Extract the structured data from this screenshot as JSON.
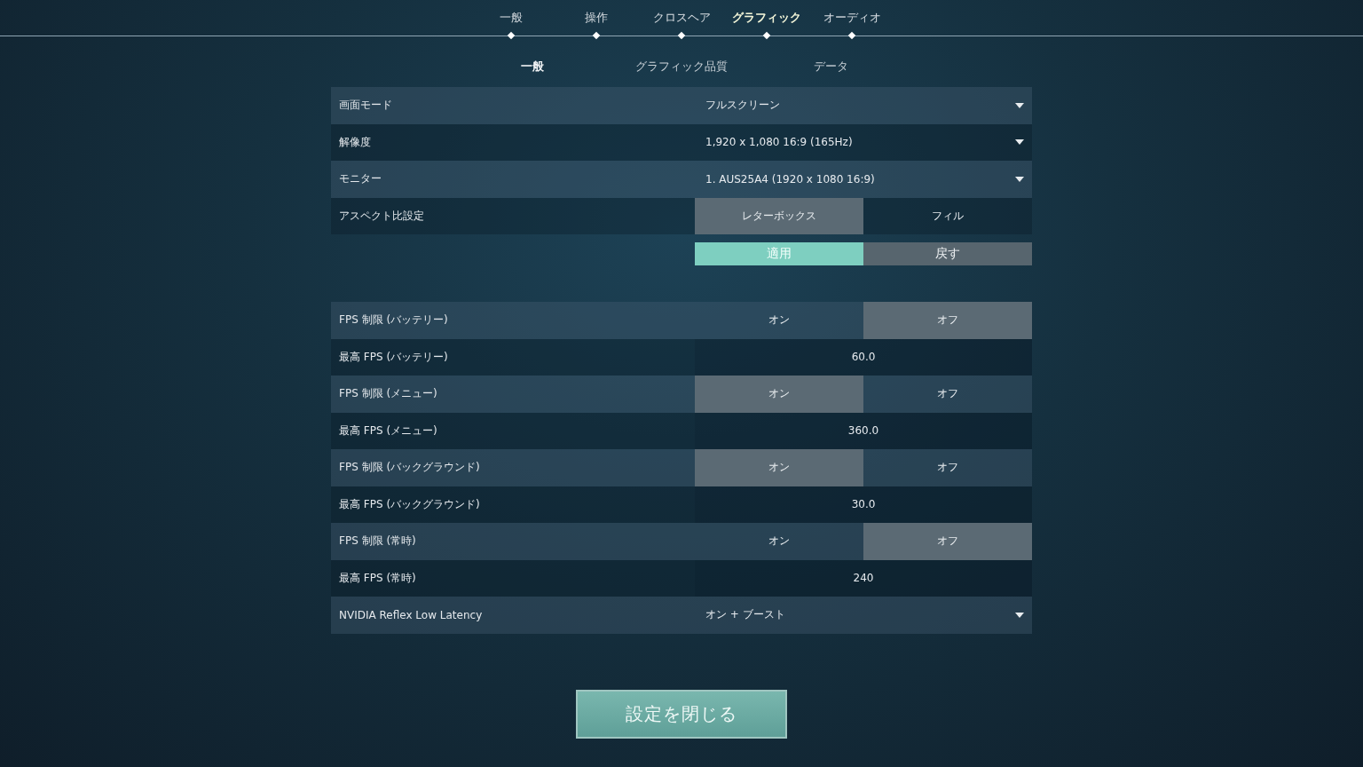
{
  "top_tabs": [
    {
      "label": "一般",
      "selected": false
    },
    {
      "label": "操作",
      "selected": false
    },
    {
      "label": "クロスヘア",
      "selected": false
    },
    {
      "label": "グラフィック",
      "selected": true
    },
    {
      "label": "オーディオ",
      "selected": false
    }
  ],
  "sub_tabs": [
    {
      "label": "一般",
      "selected": true
    },
    {
      "label": "グラフィック品質",
      "selected": false
    },
    {
      "label": "データ",
      "selected": false
    }
  ],
  "sections": [
    {
      "rows": [
        {
          "kind": "dropdown",
          "label": "画面モード",
          "value": "フルスクリーン"
        },
        {
          "kind": "dropdown",
          "label": "解像度",
          "value": "1,920 x 1,080 16:9 (165Hz)"
        },
        {
          "kind": "dropdown",
          "label": "モニター",
          "value": "1. AUS25A4 (1920 x  1080 16:9)"
        },
        {
          "kind": "toggle",
          "label": "アスペクト比設定",
          "options": [
            {
              "label": "レターボックス",
              "selected": true
            },
            {
              "label": "フィル",
              "selected": false
            }
          ]
        }
      ],
      "actions": [
        {
          "label": "適用",
          "kind": "primary"
        },
        {
          "label": "戻す",
          "kind": "secondary"
        }
      ]
    },
    {
      "rows": [
        {
          "kind": "toggle",
          "label": "FPS 制限 (バッテリー)",
          "options": [
            {
              "label": "オン",
              "selected": false
            },
            {
              "label": "オフ",
              "selected": true
            }
          ]
        },
        {
          "kind": "value",
          "label": "最高 FPS (バッテリー)",
          "value": "60.0"
        },
        {
          "kind": "toggle",
          "label": "FPS 制限 (メニュー)",
          "options": [
            {
              "label": "オン",
              "selected": true
            },
            {
              "label": "オフ",
              "selected": false
            }
          ]
        },
        {
          "kind": "value",
          "label": "最高 FPS (メニュー)",
          "value": "360.0"
        },
        {
          "kind": "toggle",
          "label": "FPS 制限 (バックグラウンド)",
          "options": [
            {
              "label": "オン",
              "selected": true
            },
            {
              "label": "オフ",
              "selected": false
            }
          ]
        },
        {
          "kind": "value",
          "label": "最高 FPS (バックグラウンド)",
          "value": "30.0"
        },
        {
          "kind": "toggle",
          "label": "FPS 制限 (常時)",
          "options": [
            {
              "label": "オン",
              "selected": false
            },
            {
              "label": "オフ",
              "selected": true
            }
          ]
        },
        {
          "kind": "value",
          "label": "最高 FPS (常時)",
          "value": "240"
        },
        {
          "kind": "dropdown",
          "label": "NVIDIA Reflex Low Latency",
          "value": "オン + ブースト"
        }
      ]
    }
  ],
  "close_button": {
    "label": "設定を閉じる"
  }
}
